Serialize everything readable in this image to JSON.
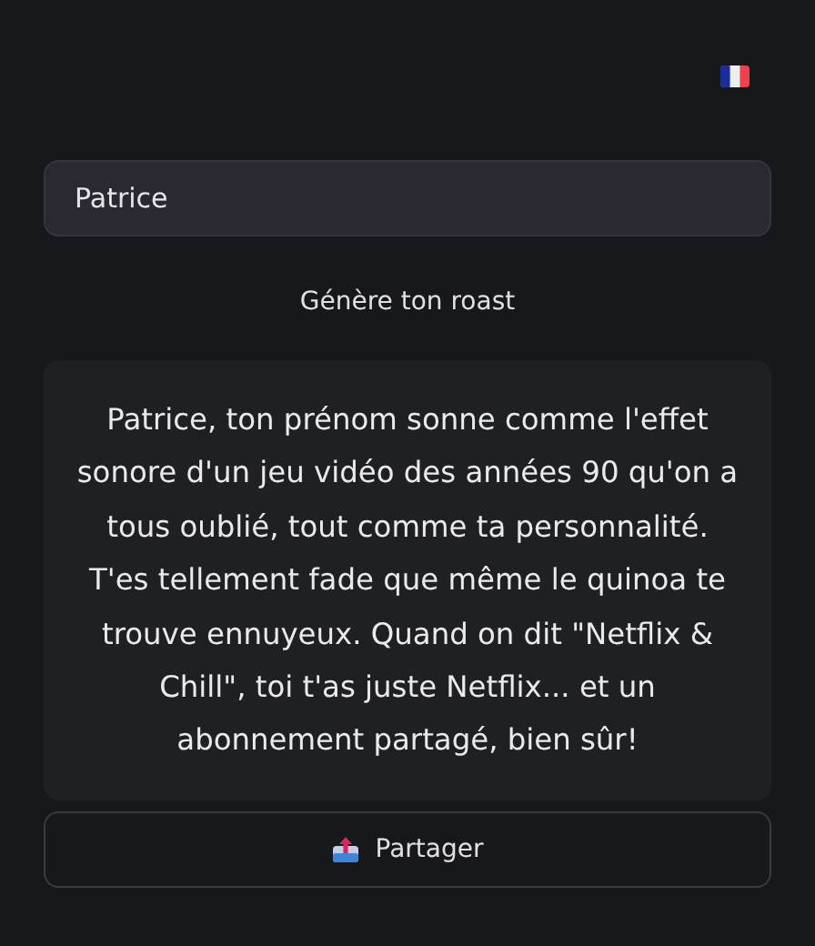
{
  "name_field": {
    "value": "Patrice"
  },
  "generate_button": {
    "label": "Génère ton roast"
  },
  "roast": {
    "text": "Patrice, ton prénom sonne comme l'effet sonore d'un jeu vidéo des années 90 qu'on a tous oublié, tout comme ta personnalité. T'es tellement fade que même le quinoa te trouve ennuyeux. Quand on dit \"Netflix & Chill\", toi t'as juste Netflix... et un abonnement partagé, bien sûr!"
  },
  "share_button": {
    "label": "Partager"
  }
}
